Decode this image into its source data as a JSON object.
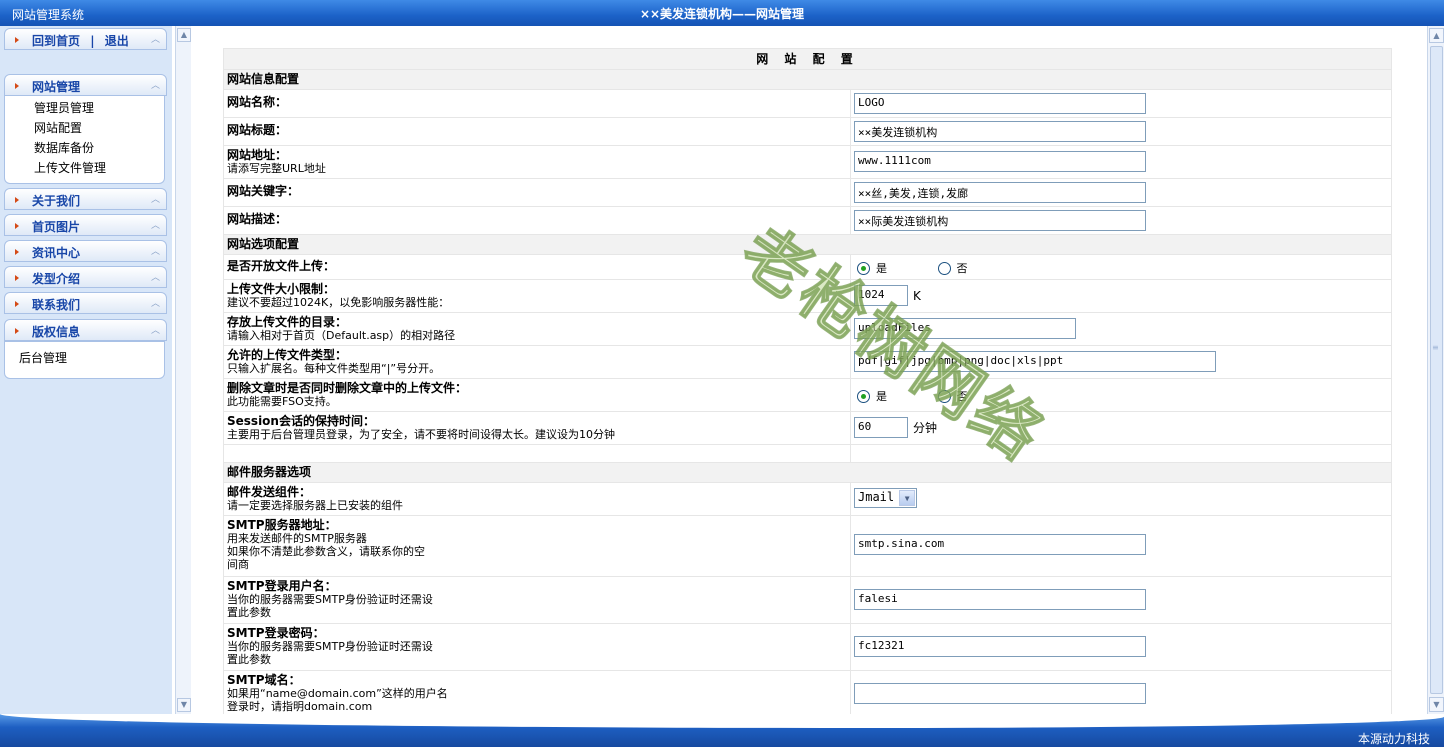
{
  "topbar": {
    "system_name": "网站管理系统",
    "title": "××美发连锁机构——网站管理"
  },
  "sidebar": {
    "top_panel": {
      "home_label": "回到首页",
      "separator": "|",
      "logout_label": "退出"
    },
    "site_admin": {
      "label": "网站管理",
      "items": [
        "管理员管理",
        "网站配置",
        "数据库备份",
        "上传文件管理"
      ]
    },
    "sections": [
      "关于我们",
      "首页图片",
      "资讯中心",
      "发型介绍",
      "联系我们",
      "版权信息"
    ],
    "footer_label": "后台管理"
  },
  "config": {
    "heading": "网 站 配 置",
    "site_info": {
      "section": "网站信息配置",
      "name_label": "网站名称：",
      "name_value": "LOGO",
      "title_label": "网站标题：",
      "title_value": "××美发连锁机构",
      "url_label": "网站地址：",
      "url_hint": "请添写完整URL地址",
      "url_value": "www.1111com",
      "keywords_label": "网站关键字：",
      "keywords_value": "××丝,美发,连锁,发廊",
      "desc_label": "网站描述：",
      "desc_value": "××际美发连锁机构"
    },
    "options": {
      "section": "网站选项配置",
      "upload_open_label": "是否开放文件上传：",
      "yes": "是",
      "no": "否",
      "upload_open_selected": "是",
      "size_label": "上传文件大小限制：",
      "size_hint": "建议不要超过1024K，以免影响服务器性能：",
      "size_value": "1024",
      "size_unit": "K",
      "dir_label": "存放上传文件的目录：",
      "dir_hint": "请输入相对于首页（Default.asp）的相对路径",
      "dir_value": "uploadFiles",
      "types_label": "允许的上传文件类型：",
      "types_hint": "只输入扩展名。每种文件类型用“|”号分开。",
      "types_value": "pdf|gif|jpg|bmp|png|doc|xls|ppt",
      "delete_label": "删除文章时是否同时删除文章中的上传文件：",
      "delete_hint": "此功能需要FSO支持。",
      "delete_selected": "是",
      "session_label": "Session会话的保持时间：",
      "session_hint": "主要用于后台管理员登录，为了安全，请不要将时间设得太长。建议设为10分钟",
      "session_value": "60",
      "session_unit": "分钟"
    },
    "mail": {
      "section": "邮件服务器选项",
      "component_label": "邮件发送组件：",
      "component_hint": "请一定要选择服务器上已安装的组件",
      "component_value": "Jmail",
      "smtp_label": "SMTP服务器地址：",
      "smtp_hint1": "用来发送邮件的SMTP服务器",
      "smtp_hint2": "如果你不清楚此参数含义，请联系你的空",
      "smtp_hint3": "间商",
      "smtp_value": "smtp.sina.com",
      "user_label": "SMTP登录用户名：",
      "user_hint1": "当你的服务器需要SMTP身份验证时还需设",
      "user_hint2": "置此参数",
      "user_value": "falesi",
      "pass_label": "SMTP登录密码：",
      "pass_hint1": "当你的服务器需要SMTP身份验证时还需设",
      "pass_hint2": "置此参数",
      "pass_value": "fc12321",
      "domain_label": "SMTP域名：",
      "domain_hint1": "如果用“name@domain.com”这样的用户名",
      "domain_hint2": "登录时，请指明domain.com",
      "domain_value": ""
    }
  },
  "watermark": "老枪树网络",
  "footer": {
    "copyright": "本源动力科技"
  },
  "colors": {
    "topbar": "#1c62c8",
    "sidebar_bg": "#d8e6f8",
    "menu_text": "#1846a8",
    "radio_dot": "#21a121"
  }
}
